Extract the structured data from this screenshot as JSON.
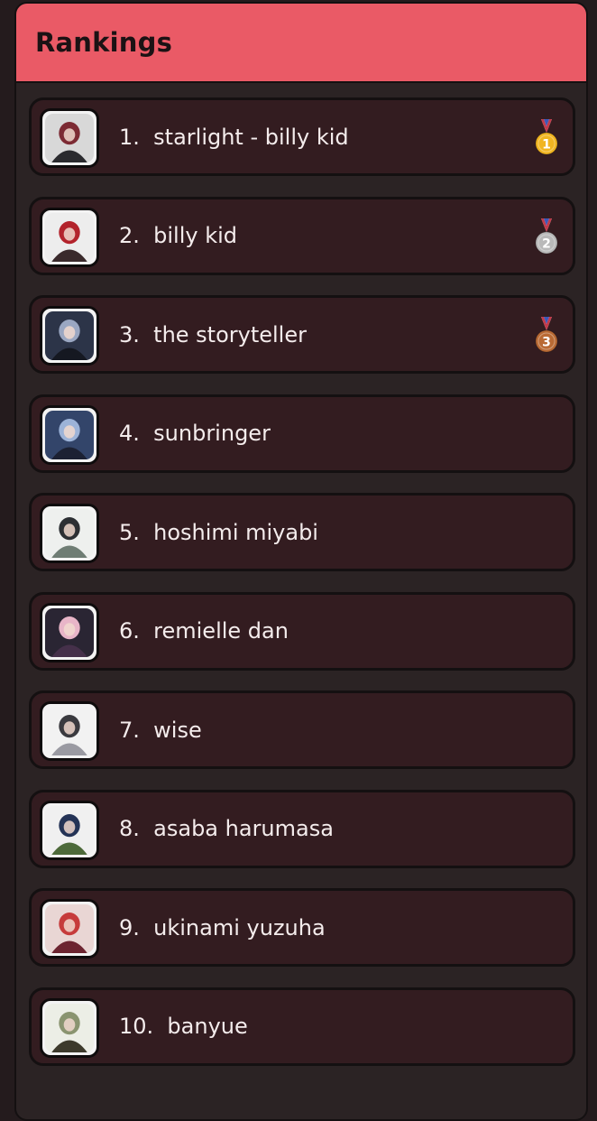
{
  "header": {
    "title": "Rankings"
  },
  "rankings": [
    {
      "label": "1.  starlight - billy kid",
      "medal": {
        "rank": "1",
        "color": "#f1b521"
      },
      "avatar_colors": [
        "#d8d8d8",
        "#7c2a33",
        "#2a2a2e"
      ]
    },
    {
      "label": "2.  billy kid",
      "medal": {
        "rank": "2",
        "color": "#b9b9b9"
      },
      "avatar_colors": [
        "#ededed",
        "#b3232c",
        "#3a2a2c"
      ]
    },
    {
      "label": "3.  the storyteller",
      "medal": {
        "rank": "3",
        "color": "#b96a34"
      },
      "avatar_colors": [
        "#2c3448",
        "#9aa7c2",
        "#151821"
      ]
    },
    {
      "label": "4.  sunbringer",
      "medal": null,
      "avatar_colors": [
        "#33456a",
        "#9cb3d8",
        "#1c2133"
      ]
    },
    {
      "label": "5.  hoshimi miyabi",
      "medal": null,
      "avatar_colors": [
        "#eef0ee",
        "#2c2f33",
        "#6f7d74"
      ]
    },
    {
      "label": "6.  remielle dan",
      "medal": null,
      "avatar_colors": [
        "#2a2533",
        "#e8b5c8",
        "#45304a"
      ]
    },
    {
      "label": "7.  wise",
      "medal": null,
      "avatar_colors": [
        "#f2f2f2",
        "#3a3a3f",
        "#9a9aa2"
      ]
    },
    {
      "label": "8.  asaba harumasa",
      "medal": null,
      "avatar_colors": [
        "#f0f0f0",
        "#243356",
        "#4d6a3a"
      ]
    },
    {
      "label": "9.  ukinami yuzuha",
      "medal": null,
      "avatar_colors": [
        "#e9d6d4",
        "#c63b3b",
        "#6c2430"
      ]
    },
    {
      "label": "10.  banyue",
      "medal": null,
      "avatar_colors": [
        "#eceee6",
        "#8a9470",
        "#3d3a2c"
      ]
    }
  ]
}
